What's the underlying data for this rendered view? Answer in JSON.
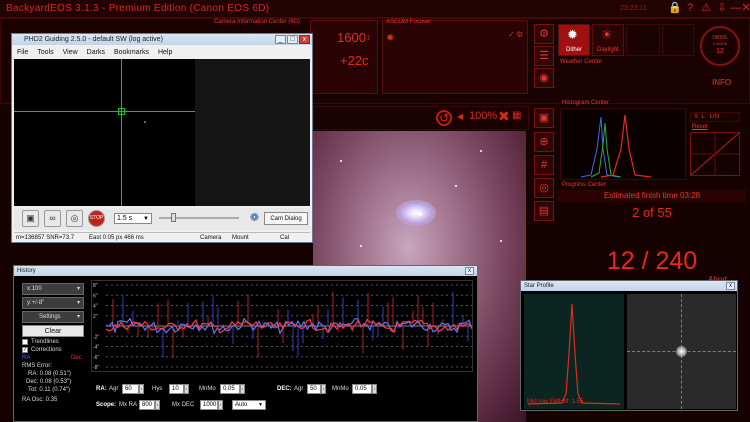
{
  "app": {
    "title": "BackyardEOS 3.1.3 - Premium Edition (Canon EOS 6D)",
    "clock": "23:22:11",
    "toolbar_icons": [
      "lock-icon",
      "help-icon",
      "bell-icon",
      "download-icon",
      "minimize-icon",
      "close-icon"
    ]
  },
  "camera_info": {
    "title": "Camera Information Center (6D)",
    "iso": "1600",
    "temp": "+22c"
  },
  "ascom": {
    "title": "ASCOM Focuser"
  },
  "modes": {
    "dither_label": "Dither",
    "daylight_label": "Daylight",
    "weather_title": "Weather Center",
    "info_label": "INFO",
    "drive_label": "DRIVE",
    "drive_line2": "2 d/d/2b",
    "drive_value": "12"
  },
  "zoom": {
    "percent": "100%",
    "fit_label": "FIT"
  },
  "histogram": {
    "title": "Histogram Center",
    "s_label": "S",
    "l_label": "L",
    "lin_label": "LIN",
    "reset_label": "Reset"
  },
  "progress": {
    "title": "Progress Center",
    "finish": "Estimated finish time 03:28",
    "count": "2 of 55",
    "frames": "12 / 240",
    "abort_label": "Abort"
  },
  "phd2": {
    "title": "PHD2 Guiding 2.5.0 - default SW (log active)",
    "menus": [
      "File",
      "Tools",
      "View",
      "Darks",
      "Bookmarks",
      "Help"
    ],
    "exposure": "1.5 s",
    "cam_dialog": "Cam Dialog",
    "status_left": "m=136857 SNR=73.7",
    "status_guide": "East 0.05 px 466 ms",
    "status_camera": "Camera",
    "status_mount": "Mount",
    "status_cal": "Cal"
  },
  "history": {
    "title": "History",
    "x_scale": "x:100",
    "y_scale": "y:+/-8\"",
    "settings_label": "Settings",
    "clear_label": "Clear",
    "trendlines_label": "Trendlines",
    "corrections_label": "Corrections",
    "ra_legend": "RA",
    "dec_legend": "Dec",
    "rms_title": "RMS Error:",
    "rms_ra": "RA: 0.08 (0.51\")",
    "rms_dec": "Dec: 0.08 (0.53\")",
    "rms_tot": "Tot: 0.11 (0.74\")",
    "ra_osc": "RA Osc: 0.35",
    "y_labels": [
      "8\"",
      "6\"",
      "4\"",
      "2\"",
      "-2\"",
      "-4\"",
      "-6\"",
      "-8\""
    ],
    "ra_label": "RA:",
    "agr_label": "Agr",
    "ra_agr": "60",
    "hys_label": "Hys",
    "ra_hys": "10",
    "mnmo_label": "MnMo",
    "ra_mnmo": "0.05",
    "dec_label": "DEC:",
    "dec_agr": "50",
    "dec_mnmo": "0.05",
    "scope_label": "Scope:",
    "mxra_label": "Mx RA",
    "mxra": "800",
    "mxdec_label": "Mx DEC",
    "mxdec": "1000",
    "dec_mode": "Auto"
  },
  "star_profile": {
    "title": "Star Profile",
    "fwhm": "Mid row FWHM: 1.55"
  }
}
